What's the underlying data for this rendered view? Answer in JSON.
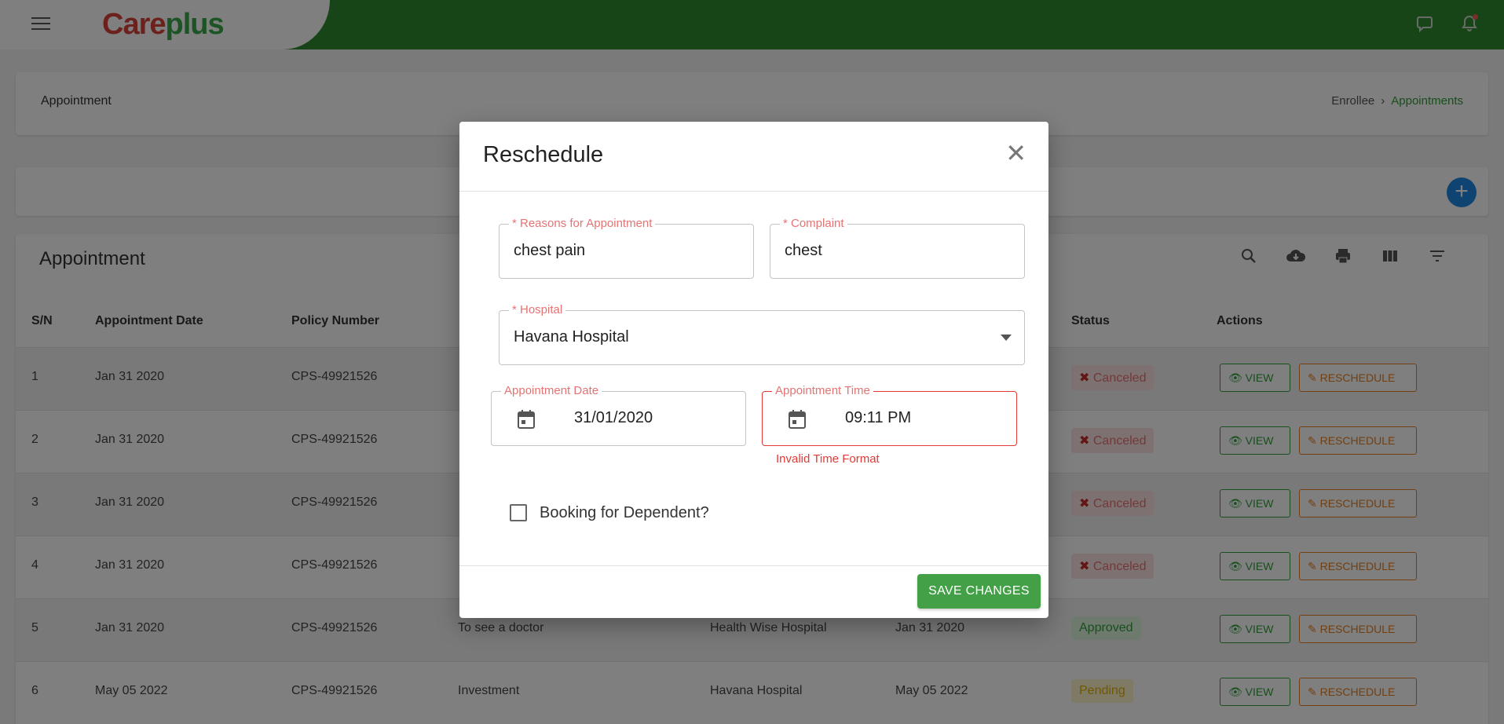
{
  "app": {
    "logo_care": "Care",
    "logo_plus": "plus"
  },
  "header": {
    "title": "Appointment",
    "breadcrumb": [
      "Enrollee",
      "Appointments"
    ]
  },
  "table": {
    "title": "Appointment",
    "columns": [
      "S/N",
      "Appointment Date",
      "Policy Number",
      "Status",
      "Actions"
    ],
    "rows": [
      {
        "sn": "1",
        "date": "Jan 31 2020",
        "policy": "CPS-49921526",
        "reason": "",
        "hospital": "",
        "appt": "",
        "status": "Canceled"
      },
      {
        "sn": "2",
        "date": "Jan 31 2020",
        "policy": "CPS-49921526",
        "reason": "",
        "hospital": "",
        "appt": "",
        "status": "Canceled"
      },
      {
        "sn": "3",
        "date": "Jan 31 2020",
        "policy": "CPS-49921526",
        "reason": "",
        "hospital": "",
        "appt": "",
        "status": "Canceled"
      },
      {
        "sn": "4",
        "date": "Jan 31 2020",
        "policy": "CPS-49921526",
        "reason": "",
        "hospital": "",
        "appt": "",
        "status": "Canceled"
      },
      {
        "sn": "5",
        "date": "Jan 31 2020",
        "policy": "CPS-49921526",
        "reason": "To see a doctor",
        "hospital": "Health Wise Hospital",
        "appt": "Jan 31 2020",
        "status": "Approved"
      },
      {
        "sn": "6",
        "date": "May 05 2022",
        "policy": "CPS-49921526",
        "reason": "Investment",
        "hospital": "Havana Hospital",
        "appt": "May 05 2022",
        "status": "Pending"
      }
    ],
    "view_label": "VIEW",
    "reschedule_label": "RESCHEDULE"
  },
  "modal": {
    "title": "Reschedule",
    "reasons_label": "* Reasons for Appointment",
    "reasons_value": "chest pain",
    "complaint_label": "* Complaint",
    "complaint_value": "chest",
    "hospital_label": "* Hospital",
    "hospital_value": "Havana Hospital",
    "date_label": "Appointment Date",
    "date_value": "31/01/2020",
    "time_label": "Appointment Time",
    "time_value": "09:11 PM",
    "time_error": "Invalid Time Format",
    "dependent_label": "Booking for Dependent?",
    "save_label": "SAVE CHANGES"
  },
  "colors": {
    "brand_green": "#2e8b2e",
    "error": "#e53935",
    "save": "#43a047"
  }
}
